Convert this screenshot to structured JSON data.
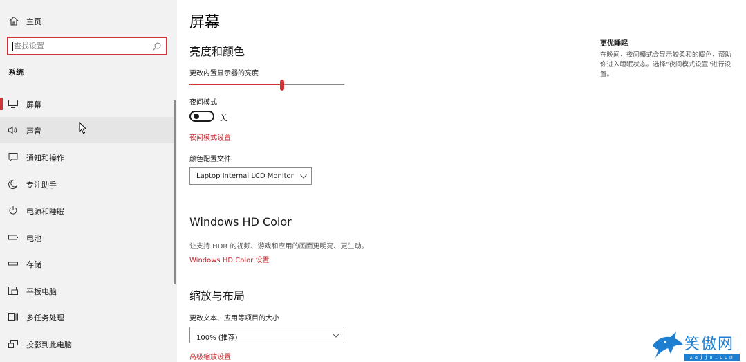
{
  "sidebar": {
    "home_label": "主页",
    "search_placeholder": "查找设置",
    "section_title": "系统",
    "items": [
      {
        "label": "屏幕",
        "icon": "monitor-icon",
        "active": true
      },
      {
        "label": "声音",
        "icon": "speaker-icon"
      },
      {
        "label": "通知和操作",
        "icon": "notification-icon"
      },
      {
        "label": "专注助手",
        "icon": "moon-icon"
      },
      {
        "label": "电源和睡眠",
        "icon": "power-icon"
      },
      {
        "label": "电池",
        "icon": "battery-icon"
      },
      {
        "label": "存储",
        "icon": "storage-icon"
      },
      {
        "label": "平板电脑",
        "icon": "tablet-icon"
      },
      {
        "label": "多任务处理",
        "icon": "multitask-icon"
      },
      {
        "label": "投影到此电脑",
        "icon": "project-icon"
      }
    ]
  },
  "main": {
    "title": "屏幕",
    "brightness": {
      "heading": "亮度和颜色",
      "slider_label": "更改内置显示器的亮度",
      "slider_value": 0.6
    },
    "night_light": {
      "label": "夜间模式",
      "state": "关",
      "settings_link": "夜间模式设置"
    },
    "color_profile": {
      "label": "颜色配置文件",
      "value": "Laptop Internal LCD Monitor"
    },
    "hdr": {
      "heading": "Windows HD Color",
      "description": "让支持 HDR 的视频、游戏和应用的画面更明亮、更生动。",
      "link": "Windows HD Color 设置"
    },
    "scale": {
      "heading": "缩放与布局",
      "label": "更改文本、应用等项目的大小",
      "value": "100% (推荐)",
      "advanced_link": "高级缩放设置"
    }
  },
  "tip": {
    "title": "更优睡眠",
    "text": "在晚间，夜间模式会显示较柔和的暖色，帮助你进入睡眠状态。选择\"夜间模式设置\"进行设置。"
  },
  "watermark": {
    "name": "笑傲网",
    "url": "xajjn.com"
  },
  "colors": {
    "accent": "#d13438",
    "link": "#c4282e",
    "sidebar_bg": "#f2f2f2"
  }
}
